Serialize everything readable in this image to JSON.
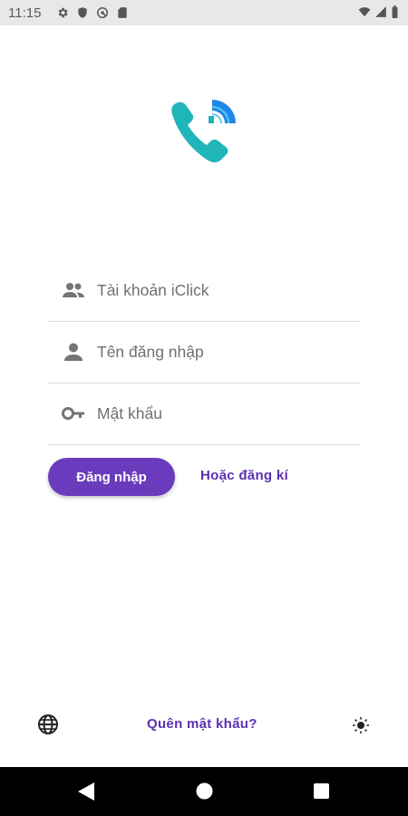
{
  "status_bar": {
    "time": "11:15",
    "icons_left": [
      "settings-icon",
      "shield-icon",
      "vpn-key-icon",
      "sd-card-icon"
    ],
    "icons_right": [
      "wifi-icon",
      "signal-icon",
      "battery-icon"
    ]
  },
  "logo": {
    "icon": "phone-wifi-logo-icon",
    "colors": [
      "#1fb5b9",
      "#1e88e5"
    ]
  },
  "form": {
    "account_placeholder": "Tài khoản iClick",
    "username_placeholder": "Tên đăng nhập",
    "password_placeholder": "Mật khẩu"
  },
  "actions": {
    "login_label": "Đăng nhập",
    "register_label": "Hoặc đăng kí",
    "forgot_label": "Quên mật khẩu?"
  },
  "colors": {
    "primary": "#6b3bbd",
    "link": "#5b2fb0"
  },
  "footer_icons": [
    "globe-icon",
    "brightness-icon"
  ],
  "nav_bar": [
    "back-icon",
    "home-icon",
    "recents-icon"
  ]
}
